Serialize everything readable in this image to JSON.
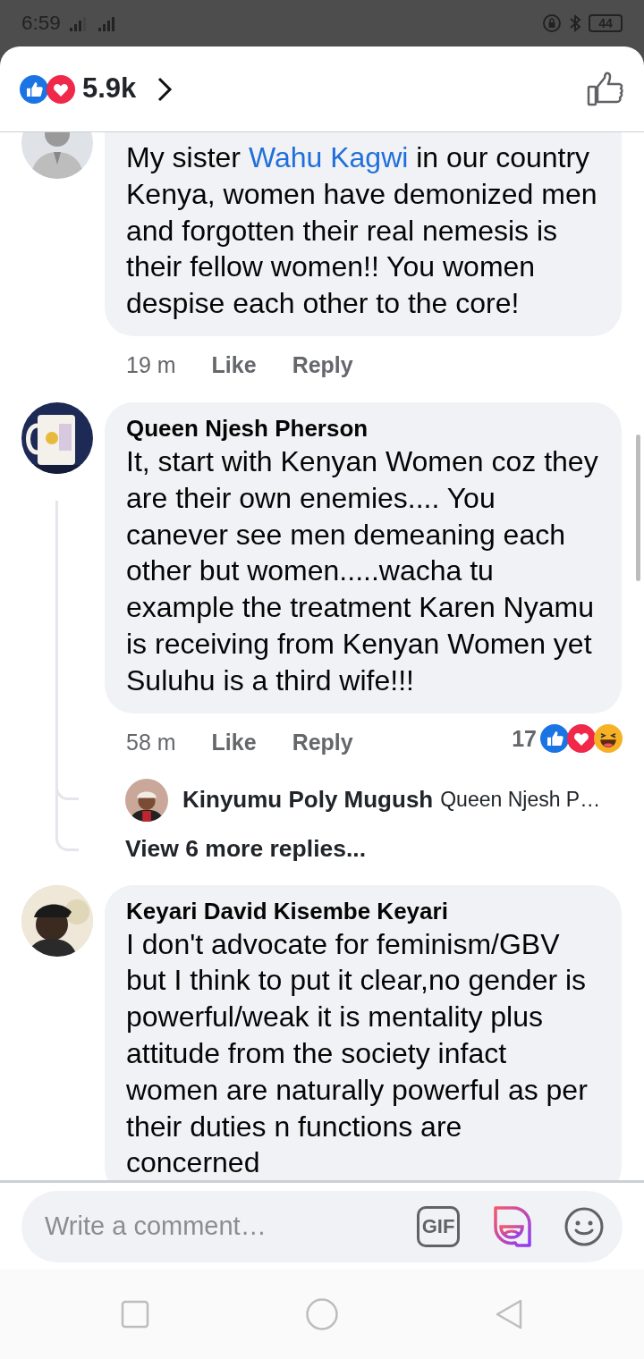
{
  "status_bar": {
    "time": "6:59",
    "battery": "44"
  },
  "header": {
    "reaction_count": "5.9k"
  },
  "comments": [
    {
      "text_parts": [
        {
          "kind": "plain",
          "text": "My sister "
        },
        {
          "kind": "mention",
          "text": "Wahu Kagwi"
        },
        {
          "kind": "plain",
          "text": " in our country Kenya, women have demonized men and forgotten their real nemesis is their fellow women!! You women despise each other to the core!"
        }
      ],
      "time": "19 m",
      "like": "Like",
      "reply": "Reply"
    },
    {
      "author": "Queen Njesh Pherson",
      "text_parts": [
        {
          "kind": "plain",
          "text": "It, start with Kenyan Women coz they are their own enemies.... You canever see men demeaning each other but women.....wacha tu example the treatment Karen Nyamu is receiving from Kenyan Women yet Suluhu is a third wife!!!"
        }
      ],
      "time": "58 m",
      "like": "Like",
      "reply": "Reply",
      "reaction_count": "17",
      "replies": [
        {
          "author": "Kinyumu Poly Mugush",
          "text": "Queen Njesh P…"
        }
      ],
      "more_replies": "View 6 more replies..."
    },
    {
      "author": "Keyari David Kisembe Keyari",
      "text_parts": [
        {
          "kind": "plain",
          "text": "I don't advocate for feminism/GBV but I think to put it clear,no gender is powerful/weak it is mentality plus attitude from the society infact women are naturally powerful as per their duties n functions are concerned"
        }
      ]
    }
  ],
  "composer": {
    "placeholder": "Write a comment…",
    "gif_label": "GIF"
  }
}
